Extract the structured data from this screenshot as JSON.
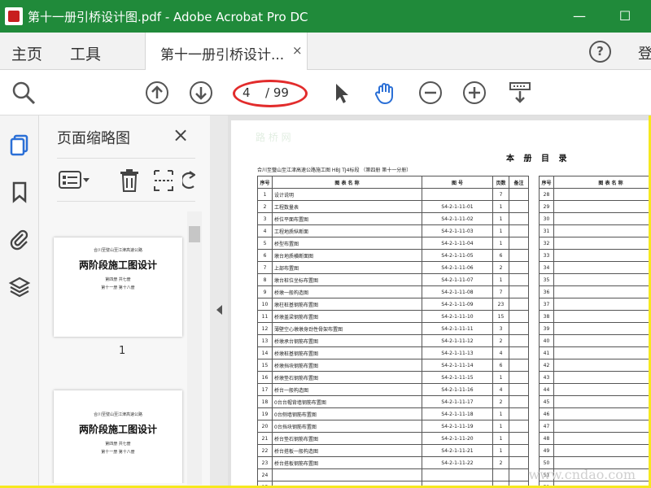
{
  "window": {
    "title": "第十一册引桥设计图.pdf - Adobe Acrobat Pro DC",
    "minimize": "—",
    "maximize": "☐"
  },
  "menu": {
    "home": "主页",
    "tools": "工具"
  },
  "tab": {
    "label": "第十一册引桥设计...",
    "close": "×"
  },
  "header_right": {
    "help": "?",
    "login": "登"
  },
  "toolbar": {
    "current_page": "4",
    "total_pages": "/ 99"
  },
  "panel": {
    "title": "页面缩略图",
    "close": "×",
    "thumb1": {
      "line1": "合川至璧山至江津高速公路",
      "heading": "两阶段施工图设计",
      "line2": "第四册 共七册",
      "line3": "第十一册 第十八册",
      "number": "1"
    },
    "thumb2": {
      "line1": "合川至璧山至江津高速公路",
      "heading": "两阶段施工图设计",
      "line2": "第四册 共七册",
      "line3": "第十一册 第十八册"
    }
  },
  "document": {
    "title": "本 册 目 录",
    "subtitle": "合川至璧山至江津高速公路施工图   HBJ TJ4标段  （第四册 第十一分册）",
    "headers": {
      "no": "序号",
      "name": "图 表 名 称",
      "code": "图  号",
      "pages": "页数",
      "remark": "备注"
    },
    "rows": [
      {
        "no": "1",
        "name": "设计说明",
        "code": "",
        "pages": "7"
      },
      {
        "no": "2",
        "name": "工程数量表",
        "code": "S4-2-1-11-01",
        "pages": "1"
      },
      {
        "no": "3",
        "name": "桥位平面布置图",
        "code": "S4-2-1-11-02",
        "pages": "1"
      },
      {
        "no": "4",
        "name": "工程地质纵断面",
        "code": "S4-2-1-11-03",
        "pages": "1"
      },
      {
        "no": "5",
        "name": "桥型布置图",
        "code": "S4-2-1-11-04",
        "pages": "1"
      },
      {
        "no": "6",
        "name": "墩台地质横断面图",
        "code": "S4-2-1-11-05",
        "pages": "6"
      },
      {
        "no": "7",
        "name": "上部布置图",
        "code": "S4-2-1-11-06",
        "pages": "2"
      },
      {
        "no": "8",
        "name": "墩台桩位坐标布置图",
        "code": "S4-2-1-11-07",
        "pages": "1"
      },
      {
        "no": "9",
        "name": "桥墩一般构造图",
        "code": "S4-2-1-11-08",
        "pages": "7"
      },
      {
        "no": "10",
        "name": "墩柱桩基钢筋布置图",
        "code": "S4-2-1-11-09",
        "pages": "23"
      },
      {
        "no": "11",
        "name": "桥墩盖梁钢筋布置图",
        "code": "S4-2-1-11-10",
        "pages": "15"
      },
      {
        "no": "12",
        "name": "薄壁空心墩墩身劲性骨架布置图",
        "code": "S4-2-1-11-11",
        "pages": "3"
      },
      {
        "no": "13",
        "name": "桥墩承台钢筋布置图",
        "code": "S4-2-1-11-12",
        "pages": "2"
      },
      {
        "no": "14",
        "name": "桥墩桩基钢筋布置图",
        "code": "S4-2-1-11-13",
        "pages": "4"
      },
      {
        "no": "15",
        "name": "桥墩挡块钢筋布置图",
        "code": "S4-2-1-11-14",
        "pages": "6"
      },
      {
        "no": "16",
        "name": "桥墩垫石钢筋布置图",
        "code": "S4-2-1-11-15",
        "pages": "1"
      },
      {
        "no": "17",
        "name": "桥台一般构造图",
        "code": "S4-2-1-11-16",
        "pages": "4"
      },
      {
        "no": "18",
        "name": "0台台帽背墙钢筋布置图",
        "code": "S4-2-1-11-17",
        "pages": "2"
      },
      {
        "no": "19",
        "name": "0台侧墙钢筋布置图",
        "code": "S4-2-1-11-18",
        "pages": "1"
      },
      {
        "no": "20",
        "name": "0台挡块钢筋布置图",
        "code": "S4-2-1-11-19",
        "pages": "1"
      },
      {
        "no": "21",
        "name": "桥台垫石钢筋布置图",
        "code": "S4-2-1-11-20",
        "pages": "1"
      },
      {
        "no": "22",
        "name": "桥台搭板一般构造图",
        "code": "S4-2-1-11-21",
        "pages": "1"
      },
      {
        "no": "23",
        "name": "桥台搭板钢筋布置图",
        "code": "S4-2-1-11-22",
        "pages": "2"
      },
      {
        "no": "24",
        "name": "",
        "code": "",
        "pages": ""
      },
      {
        "no": "25",
        "name": "",
        "code": "",
        "pages": ""
      }
    ],
    "right_headers": {
      "no": "序号",
      "name": "图 表 名 称"
    },
    "right_rows": [
      "28",
      "29",
      "30",
      "31",
      "32",
      "33",
      "34",
      "35",
      "36",
      "37",
      "38",
      "39",
      "40",
      "41",
      "42",
      "43",
      "44",
      "45",
      "46",
      "47",
      "48",
      "49",
      "50",
      "51",
      "52"
    ],
    "watermark": "www.cndao.com",
    "watermark_top": "路 桥 网"
  },
  "colors": {
    "titlebar": "#208a3a",
    "frame": "#f6e81e",
    "annotation": "#e22c2c",
    "accent_blue": "#2a6fd6"
  }
}
